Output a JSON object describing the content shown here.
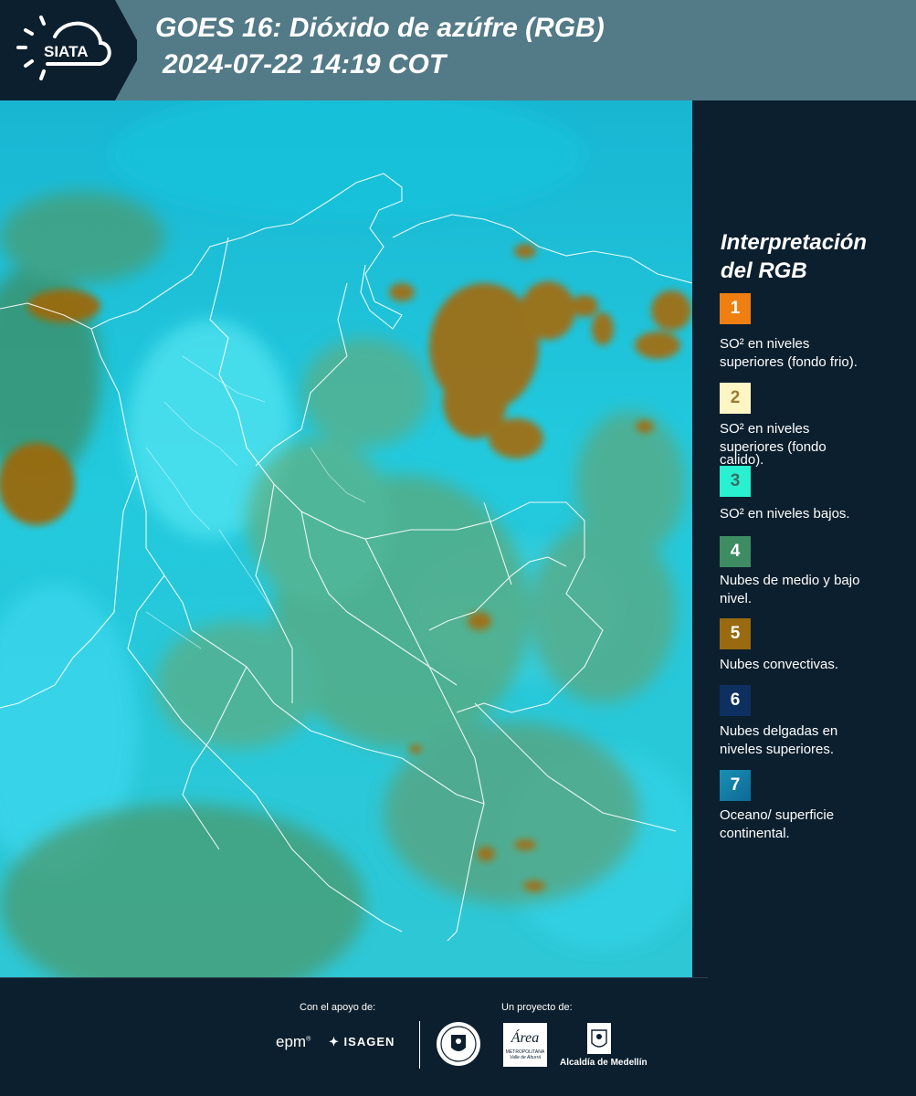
{
  "header": {
    "logo_text": "SIATA",
    "title_line1": "GOES 16: Dióxido de azúfre (RGB)",
    "title_line2": "2024-07-22 14:19 COT",
    "bg_color": "#537a87"
  },
  "legend": {
    "title_line1": "Interpretación",
    "title_line2": "del RGB",
    "items": [
      {
        "num": "1",
        "color": "#f07f12",
        "text1": "SO² en niveles",
        "text2": "superiores (fondo frio)."
      },
      {
        "num": "2",
        "color": "#fdf6c4",
        "text1": "SO² en niveles",
        "text2": "superiores (fondo",
        "text3": "calido)."
      },
      {
        "num": "3",
        "color": "#28f0d0",
        "text1": "SO² en niveles bajos."
      },
      {
        "num": "4",
        "color": "#3e8c62",
        "text1": "Nubes de medio y bajo",
        "text2": "nivel."
      },
      {
        "num": "5",
        "color": "#9a6a10",
        "text1": "Nubes convectivas."
      },
      {
        "num": "6",
        "color": "#0d3060",
        "text1": "Nubes delgadas en",
        "text2": "niveles superiores."
      },
      {
        "num": "7",
        "color": "#1a8fb4",
        "text1": "Oceano/ superficie",
        "text2": "continental."
      }
    ]
  },
  "footer": {
    "support_label": "Con el apoyo de:",
    "project_label": "Un proyecto de:",
    "sponsor1": "epm",
    "sponsor2": "ISAGEN",
    "org1_text": "Área",
    "org1_sub": "METROPOLITANA",
    "org1_sub2": "Valle de Aburrá",
    "org2": "Alcaldía de Medellín"
  }
}
